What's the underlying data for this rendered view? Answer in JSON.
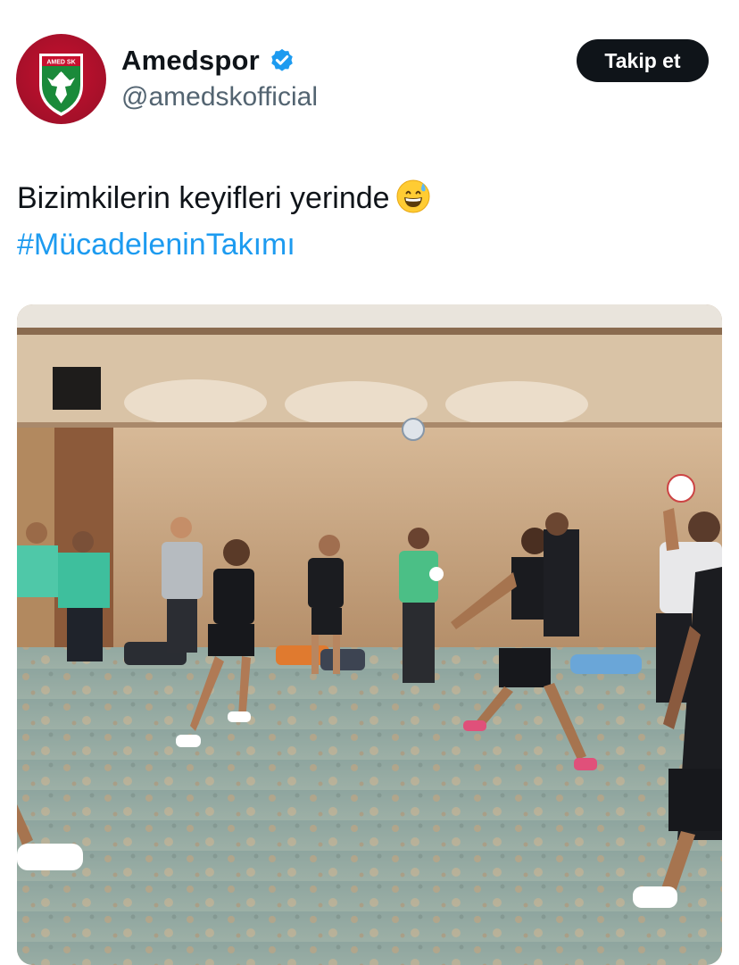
{
  "account": {
    "display_name": "Amedspor",
    "handle": "@amedskofficial",
    "verified": true,
    "avatar_icon": "amedspor-crest-logo",
    "avatar_logo_text": "AMED SK",
    "verified_icon": "verified-badge-icon"
  },
  "follow_button": {
    "label": "Takip et"
  },
  "tweet": {
    "text": "Bizimkilerin keyifleri yerinde",
    "emoji": "grinning-face-with-sweat",
    "hashtag": "#MücadeleninTakımı"
  },
  "media": {
    "type": "video",
    "description_icon": "video-thumbnail"
  },
  "colors": {
    "text": "#0f1419",
    "secondary_text": "#536471",
    "accent": "#1d9bf0",
    "follow_button_bg": "#0f1419",
    "crest_red": "#c8102e",
    "crest_green": "#1a8a3a"
  }
}
